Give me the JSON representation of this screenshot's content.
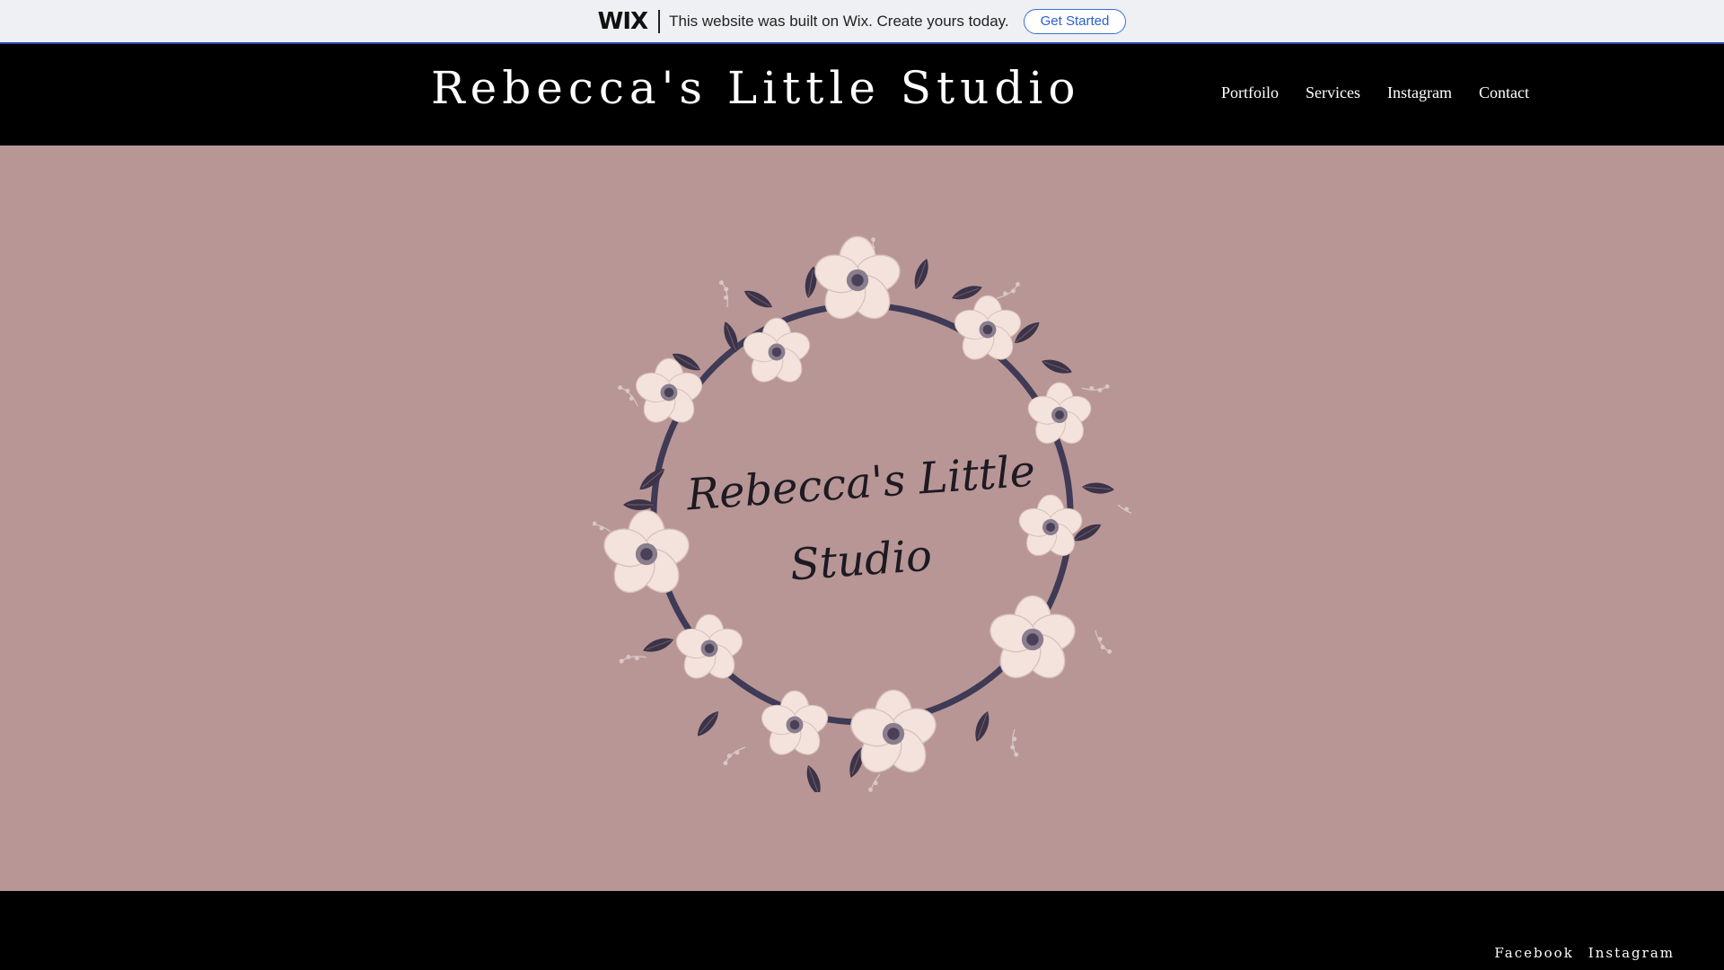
{
  "wix_banner": {
    "logo": "WIX",
    "message": "This website was built on Wix. Create yours today.",
    "button_label": "Get Started"
  },
  "header": {
    "title": "Rebecca's Little Studio",
    "nav": [
      "Portfoilo",
      "Services",
      "Instagram",
      "Contact"
    ]
  },
  "hero": {
    "logo_line1": "Rebecca's Little",
    "logo_line2": "Studio",
    "background_color": "#b89696",
    "wreath_colors": {
      "petal": "#f3e3dc",
      "leaf": "#3d3347",
      "ring": "#3f3a55"
    }
  },
  "footer": {
    "links": [
      "Facebook",
      "Instagram"
    ]
  }
}
